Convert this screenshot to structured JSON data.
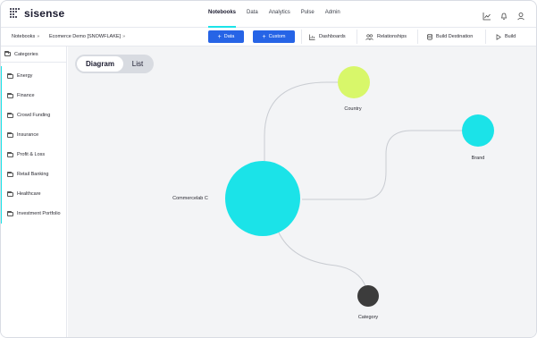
{
  "app": {
    "logo_text": "sisense"
  },
  "nav": {
    "items": [
      {
        "label": "Notebooks",
        "active": true
      },
      {
        "label": "Data",
        "active": false
      },
      {
        "label": "Analytics",
        "active": false
      },
      {
        "label": "Pulse",
        "active": false
      },
      {
        "label": "Admin",
        "active": false
      }
    ]
  },
  "header_icons": [
    "chart-line-icon",
    "bell-icon",
    "user-icon"
  ],
  "breadcrumb": {
    "root": "Notebooks",
    "current": "Ecomerce Demo [SNOWFLAKE]",
    "chevron": "»"
  },
  "toolbar": {
    "add_data_label": "Data",
    "add_custom_label": "Custom",
    "plus": "+",
    "dashboards_label": "Dashboards",
    "relationships_label": "Relationships",
    "build_destination_label": "Build Destination",
    "build_label": "Build"
  },
  "sidebar": {
    "header": "Categories",
    "items": [
      {
        "label": "Energy"
      },
      {
        "label": "Finance"
      },
      {
        "label": "Crowd Funding"
      },
      {
        "label": "Insurance"
      },
      {
        "label": "Profit & Loss"
      },
      {
        "label": "Retail Banking"
      },
      {
        "label": "Healthcare"
      },
      {
        "label": "Investment Portfolio"
      }
    ]
  },
  "view_toggle": {
    "diagram_label": "Diagram",
    "list_label": "List",
    "selected": "Diagram"
  },
  "diagram": {
    "colors": {
      "center": "#1be3e8",
      "country": "#d8f76a",
      "brand": "#1be3e8",
      "category": "#3c3c3c",
      "edge": "#c9ccd2"
    },
    "nodes": [
      {
        "id": "center",
        "label": "Commercelab C"
      },
      {
        "id": "country",
        "label": "Country"
      },
      {
        "id": "brand",
        "label": "Brand"
      },
      {
        "id": "category",
        "label": "Category"
      }
    ]
  }
}
